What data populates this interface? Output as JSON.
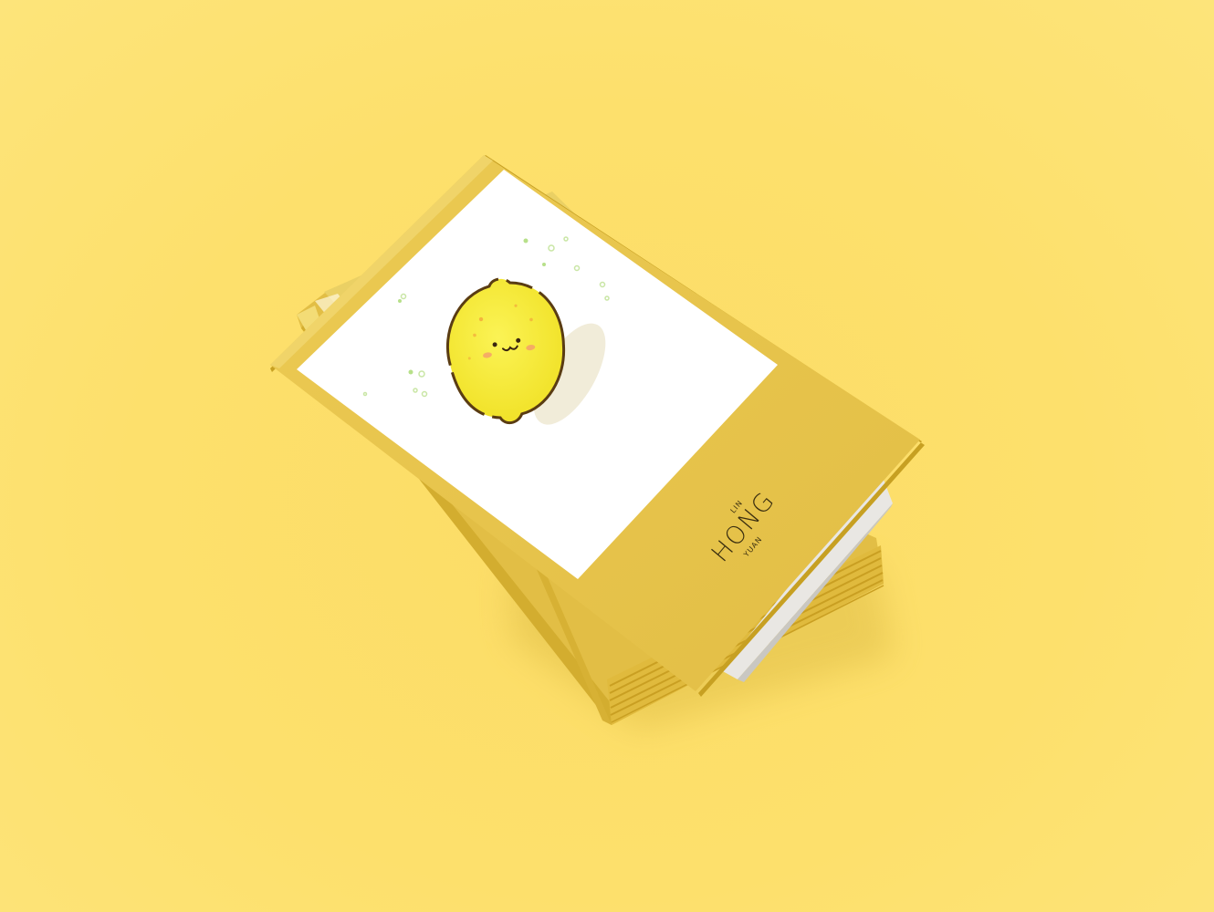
{
  "card": {
    "name_top": "LIN",
    "name_main": "HONG",
    "name_bottom": "YUAN"
  },
  "colors": {
    "background": "#fde06c",
    "card_yellow": "#e6c349",
    "card_yellow_light": "#ebcb55",
    "panel_white": "#ffffff",
    "lemon": "#f7ef3c",
    "lemon_outline": "#5a3c13",
    "text": "#3b2f10"
  },
  "illustration": {
    "subject": "lemon-character-icon"
  }
}
